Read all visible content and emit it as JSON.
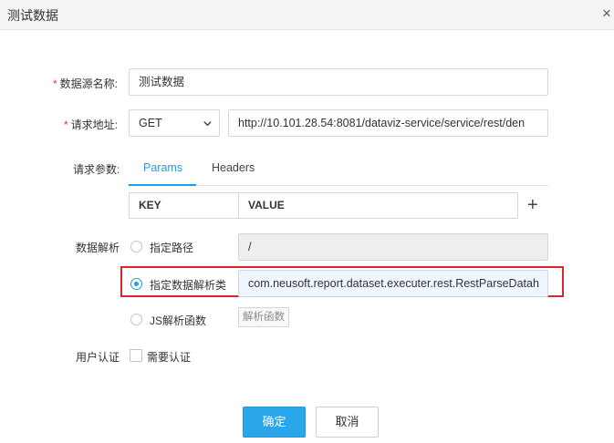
{
  "dialog": {
    "title": "测试数据",
    "close_glyph": "×"
  },
  "form": {
    "datasource_name": {
      "required_mark": "*",
      "label": "数据源名称:",
      "value": "测试数据"
    },
    "request_url": {
      "required_mark": "*",
      "label": "请求地址:",
      "method": "GET",
      "url": "http://10.101.28.54:8081/dataviz-service/service/rest/den"
    },
    "request_params": {
      "label": "请求参数:",
      "tabs": [
        {
          "label": "Params",
          "active": true
        },
        {
          "label": "Headers",
          "active": false
        }
      ],
      "columns": [
        "KEY",
        "VALUE"
      ],
      "add_glyph": "+"
    },
    "data_parse": {
      "label": "数据解析",
      "options": [
        {
          "label": "指定路径",
          "checked": false,
          "value": "/"
        },
        {
          "label": "指定数据解析类",
          "checked": true,
          "value": "com.neusoft.report.dataset.executer.rest.RestParseDatah"
        },
        {
          "label": "JS解析函数",
          "checked": false,
          "button": "解析函数"
        }
      ]
    },
    "user_auth": {
      "label": "用户认证",
      "checkbox_label": "需要认证",
      "checked": false
    }
  },
  "footer": {
    "confirm": "确定",
    "cancel": "取消"
  },
  "colors": {
    "accent": "#1e9fe6",
    "primary_button": "#2aa6ea",
    "highlight_border": "#d9262b",
    "required": "#e03a3a"
  }
}
